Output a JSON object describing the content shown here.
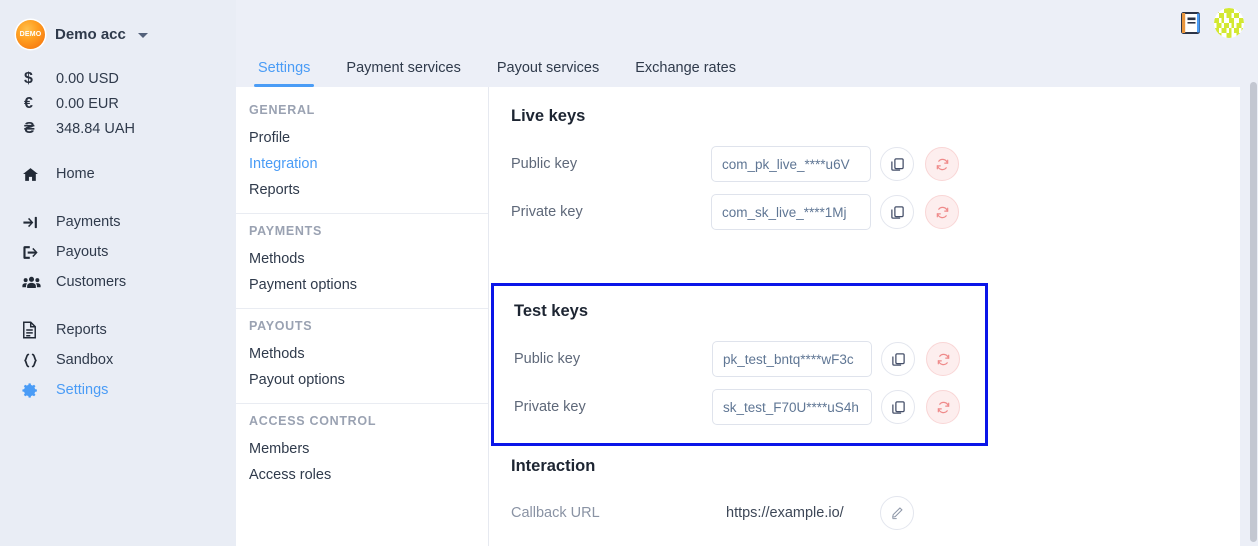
{
  "sidebar": {
    "account": {
      "name": "Demo acc",
      "badge_text": "DEMO",
      "chevron": "chevron-down-icon"
    },
    "balances": [
      {
        "symbol": "$",
        "amount": "0.00 USD"
      },
      {
        "symbol": "€",
        "amount": "0.00 EUR"
      },
      {
        "symbol": "₴",
        "amount": "348.84 UAH"
      }
    ],
    "nav_primary": [
      {
        "label": "Home",
        "icon": "home-icon",
        "active": false
      }
    ],
    "nav_secondary": [
      {
        "label": "Payments",
        "icon": "payments-arrow-in-icon",
        "active": false
      },
      {
        "label": "Payouts",
        "icon": "payouts-arrow-out-icon",
        "active": false
      },
      {
        "label": "Customers",
        "icon": "customers-people-icon",
        "active": false
      }
    ],
    "nav_tertiary": [
      {
        "label": "Reports",
        "icon": "reports-document-icon",
        "active": false
      },
      {
        "label": "Sandbox",
        "icon": "sandbox-braces-icon",
        "active": false
      },
      {
        "label": "Settings",
        "icon": "settings-gear-icon",
        "active": true
      }
    ]
  },
  "topbar": {
    "docs_icon": "book-icon",
    "avatar": "user-identicon-avatar",
    "avatar_color": "#d3e833"
  },
  "tabs": [
    {
      "label": "Settings",
      "active": true
    },
    {
      "label": "Payment services",
      "active": false
    },
    {
      "label": "Payout services",
      "active": false
    },
    {
      "label": "Exchange rates",
      "active": false
    }
  ],
  "subnav": [
    {
      "header": "GENERAL",
      "items": [
        {
          "label": "Profile",
          "active": false
        },
        {
          "label": "Integration",
          "active": true
        },
        {
          "label": "Reports",
          "active": false
        }
      ]
    },
    {
      "header": "PAYMENTS",
      "items": [
        {
          "label": "Methods",
          "active": false
        },
        {
          "label": "Payment options",
          "active": false
        }
      ]
    },
    {
      "header": "PAYOUTS",
      "items": [
        {
          "label": "Methods",
          "active": false
        },
        {
          "label": "Payout options",
          "active": false
        }
      ]
    },
    {
      "header": "ACCESS CONTROL",
      "items": [
        {
          "label": "Members",
          "active": false
        },
        {
          "label": "Access roles",
          "active": false
        }
      ]
    }
  ],
  "live_keys": {
    "title": "Live keys",
    "public": {
      "label": "Public key",
      "value": "com_pk_live_****u6V"
    },
    "private": {
      "label": "Private key",
      "value": "com_sk_live_****1Mj"
    },
    "copy_icon": "copy-icon",
    "regenerate_icon": "refresh-icon"
  },
  "test_keys": {
    "title": "Test keys",
    "public": {
      "label": "Public key",
      "value": "pk_test_bntq****wF3c"
    },
    "private": {
      "label": "Private key",
      "value": "sk_test_F70U****uS4h"
    },
    "copy_icon": "copy-icon",
    "regenerate_icon": "refresh-icon",
    "highlight_color": "#0b16e8"
  },
  "interaction": {
    "title": "Interaction",
    "callback": {
      "label": "Callback URL",
      "value": "https://example.io/",
      "edit_icon": "pencil-icon"
    }
  },
  "colors": {
    "accent_blue": "#4a9cf6",
    "sidebar_bg": "#e9edf5",
    "page_bg": "#eceff7",
    "danger": "#ef8a8a",
    "highlight": "#0b16e8"
  }
}
